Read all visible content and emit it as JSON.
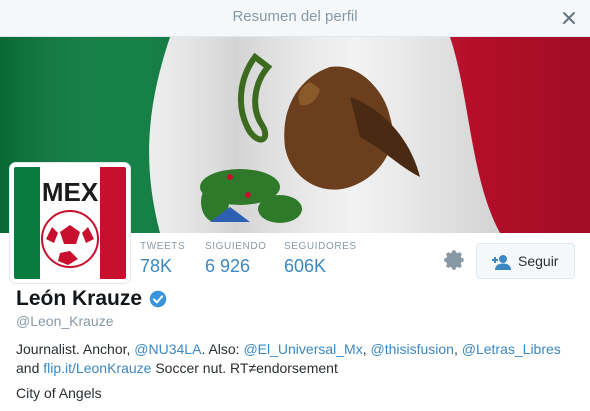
{
  "modal": {
    "title": "Resumen del perfil",
    "close_icon": "close-icon"
  },
  "avatar": {
    "logo_text": "MEX"
  },
  "stats": [
    {
      "label": "TWEETS",
      "value": "78K"
    },
    {
      "label": "SIGUIENDO",
      "value": "6 926"
    },
    {
      "label": "SEGUIDORES",
      "value": "606K"
    }
  ],
  "actions": {
    "settings_icon": "gear-icon",
    "follow_label": "Seguir",
    "follow_icon": "add-user-icon"
  },
  "profile": {
    "name": "León Krauze",
    "handle": "@Leon_Krauze",
    "verified_icon": "verified-badge-icon",
    "bio": {
      "t1": "Journalist. Anchor, ",
      "m1": "@NU34LA",
      "t2": ". Also: ",
      "m2": "@El_Universal_Mx",
      "t3": ", ",
      "m3": "@thisisfusion",
      "t4": ", ",
      "m4": "@Letras_Libres",
      "t5": "and ",
      "link": "flip.it/LeonKrauze",
      "t6": " Soccer nut. RT≠endorsement"
    },
    "location": "City of Angels"
  },
  "colors": {
    "link": "#3b88c3",
    "flag_green": "#0a7b3e",
    "flag_red": "#c8102e",
    "muted": "#8899a6"
  }
}
